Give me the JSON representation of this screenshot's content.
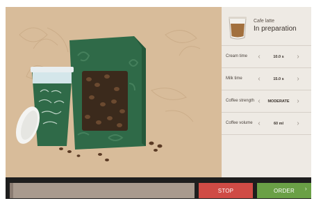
{
  "product": {
    "name": "Cafe latte",
    "status": "In preparation"
  },
  "settings": [
    {
      "label": "Cream time",
      "value": "10.0 s"
    },
    {
      "label": "Milk time",
      "value": "15.0 s"
    },
    {
      "label": "Coffee strength",
      "value": "MODERATE"
    },
    {
      "label": "Coffee volume",
      "value": "60 ml"
    }
  ],
  "controls": {
    "prev_glyph": "‹",
    "next_glyph": "›",
    "progress_fraction": 0.02
  },
  "buttons": {
    "stop": "STOP",
    "order": "ORDER"
  },
  "colors": {
    "stop": "#cf4b45",
    "order": "#6aa046",
    "hero_background": "#d8bc9a",
    "package_green": "#2f6a48"
  },
  "icons": {
    "product": "coffee-cup-icon",
    "prev": "chevron-left-icon",
    "next": "chevron-right-icon"
  }
}
